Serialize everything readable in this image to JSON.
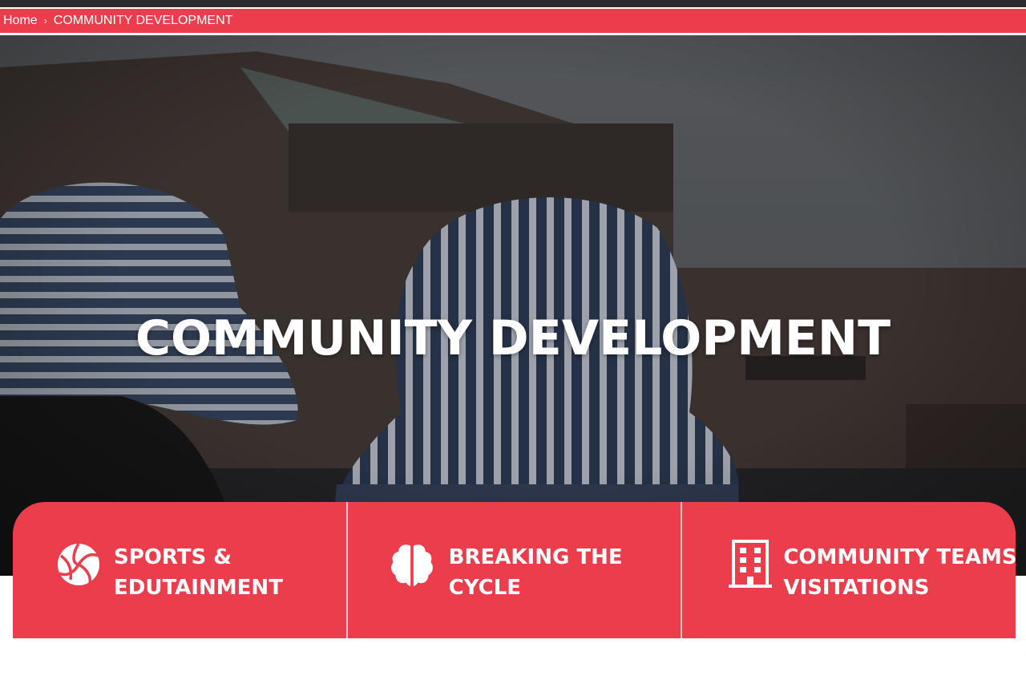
{
  "breadcrumb": {
    "home": "Home",
    "separator": "›",
    "current": "COMMUNITY DEVELOPMENT"
  },
  "hero": {
    "title": "COMMUNITY DEVELOPMENT"
  },
  "cards": [
    {
      "line1": "SPORTS &",
      "line2": "EDUTAINMENT",
      "icon": "volleyball-icon"
    },
    {
      "line1": "BREAKING THE",
      "line2": "CYCLE",
      "icon": "brain-icon"
    },
    {
      "line1": "COMMUNITY TEAMS",
      "line2": "VISITATIONS",
      "icon": "building-icon"
    }
  ],
  "colors": {
    "accent": "#ec3d4c",
    "topbar": "#2b2b2e",
    "text_on_accent": "#ffffff"
  }
}
